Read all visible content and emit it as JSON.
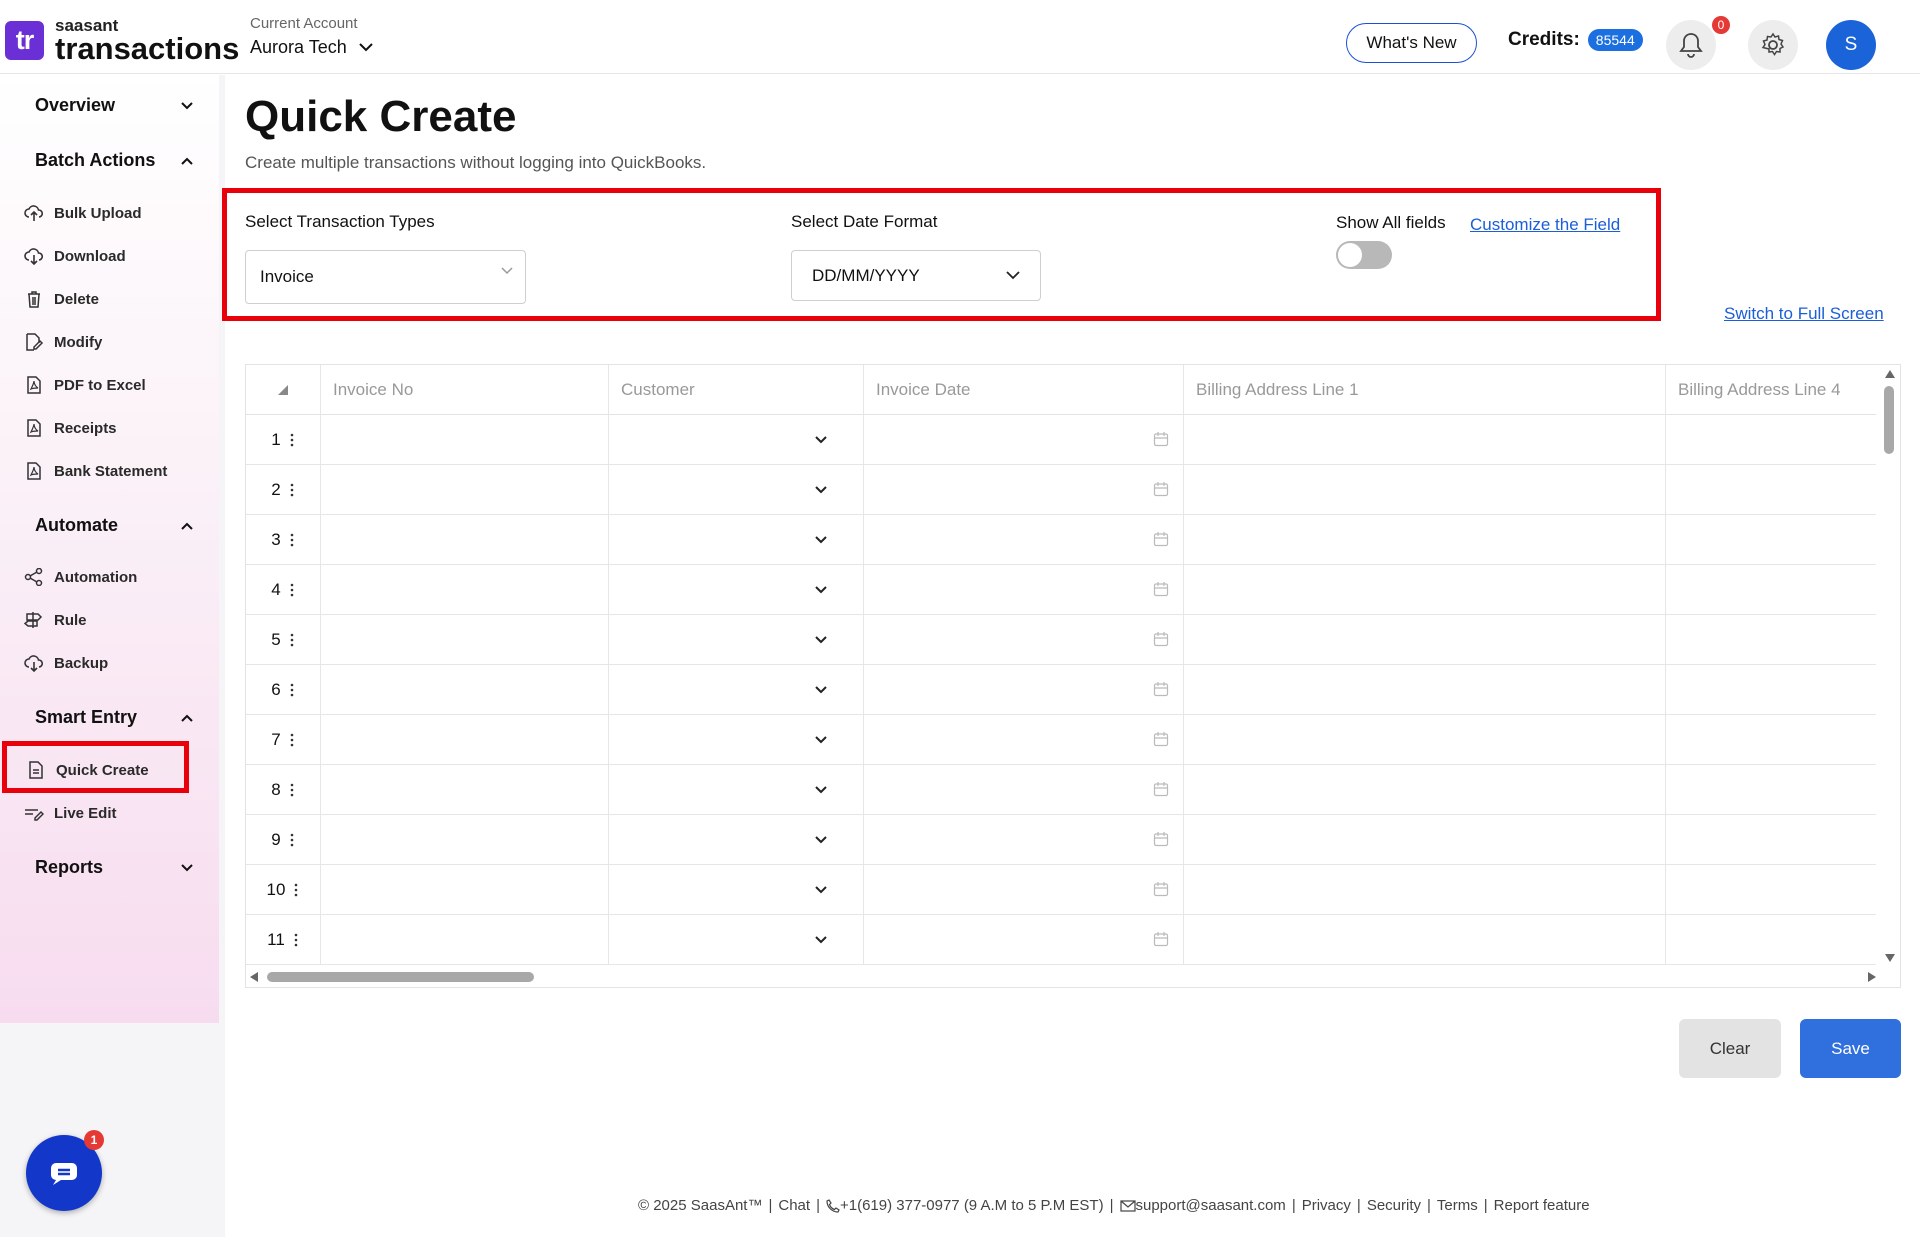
{
  "header": {
    "logo_mark": "tr",
    "logo_brand": "saasant",
    "logo_product": "transactions",
    "account_label": "Current Account",
    "account_name": "Aurora Tech",
    "whats_new": "What's New",
    "credits_label": "Credits:",
    "credits_value": "85544",
    "notification_count": "0",
    "avatar_initial": "S"
  },
  "sidebar": {
    "overview": "Overview",
    "batch_actions": "Batch Actions",
    "batch_items": [
      "Bulk Upload",
      "Download",
      "Delete",
      "Modify",
      "PDF to Excel",
      "Receipts",
      "Bank Statement"
    ],
    "automate": "Automate",
    "automate_items": [
      "Automation",
      "Rule",
      "Backup"
    ],
    "smart_entry": "Smart Entry",
    "smart_items": [
      "Quick Create",
      "Live Edit"
    ],
    "reports": "Reports",
    "chat_badge": "1"
  },
  "main": {
    "title": "Quick Create",
    "subtitle": "Create multiple transactions without logging into QuickBooks.",
    "transaction_type_label": "Select Transaction Types",
    "transaction_type_value": "Invoice",
    "date_format_label": "Select Date Format",
    "date_format_value": "DD/MM/YYYY",
    "show_all_fields": "Show All fields",
    "show_all_fields_on": false,
    "customize_link": "Customize the Field",
    "fullscreen_link": "Switch to Full Screen"
  },
  "grid": {
    "columns": [
      "Invoice No",
      "Customer",
      "Invoice Date",
      "Billing Address Line 1",
      "Billing Address Line 4"
    ],
    "rows": [
      "1",
      "2",
      "3",
      "4",
      "5",
      "6",
      "7",
      "8",
      "9",
      "10",
      "11"
    ]
  },
  "actions": {
    "clear": "Clear",
    "save": "Save"
  },
  "footer": {
    "copyright": "© 2025 SaasAnt™",
    "chat": "Chat",
    "phone": "+1(619) 377-0977 (9 A.M to 5 P.M EST)",
    "email": "support@saasant.com",
    "privacy": "Privacy",
    "security": "Security",
    "terms": "Terms",
    "report": "Report feature"
  },
  "colors": {
    "accent": "#2f6fde",
    "highlight_border": "#e8000b",
    "logo": "#6b2fd6"
  }
}
